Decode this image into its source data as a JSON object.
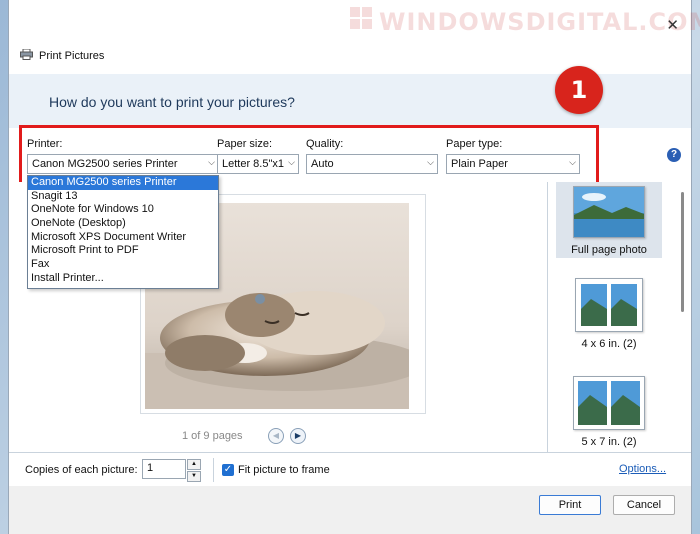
{
  "watermark": "WINDOWSDIGITAL.COM",
  "window": {
    "title": "Print Pictures"
  },
  "header": {
    "question": "How do you want to print your pictures?"
  },
  "annotation": {
    "step": "1",
    "color": "#d8241c"
  },
  "options": {
    "printer_label": "Printer:",
    "printer_value": "Canon MG2500 series Printer",
    "paper_size_label": "Paper size:",
    "paper_size_value": "Letter 8.5\"x1",
    "quality_label": "Quality:",
    "quality_value": "Auto",
    "paper_type_label": "Paper type:",
    "paper_type_value": "Plain Paper",
    "help": "?"
  },
  "printer_dropdown": {
    "items": [
      "Canon MG2500 series Printer",
      "Snagit 13",
      "OneNote for Windows 10",
      "OneNote (Desktop)",
      "Microsoft XPS Document Writer",
      "Microsoft Print to PDF",
      "Fax",
      "Install Printer..."
    ],
    "selected_index": 0
  },
  "preview": {
    "pages": "1 of 9 pages"
  },
  "layouts": [
    {
      "label": "Full page photo",
      "selected": true
    },
    {
      "label": "4 x 6 in. (2)",
      "selected": false
    },
    {
      "label": "5 x 7 in. (2)",
      "selected": false
    }
  ],
  "bottom": {
    "copies_label": "Copies of each picture:",
    "copies_value": "1",
    "fit_label": "Fit picture to frame",
    "fit_checked": true,
    "options_link": "Options..."
  },
  "footer": {
    "print": "Print",
    "cancel": "Cancel"
  }
}
